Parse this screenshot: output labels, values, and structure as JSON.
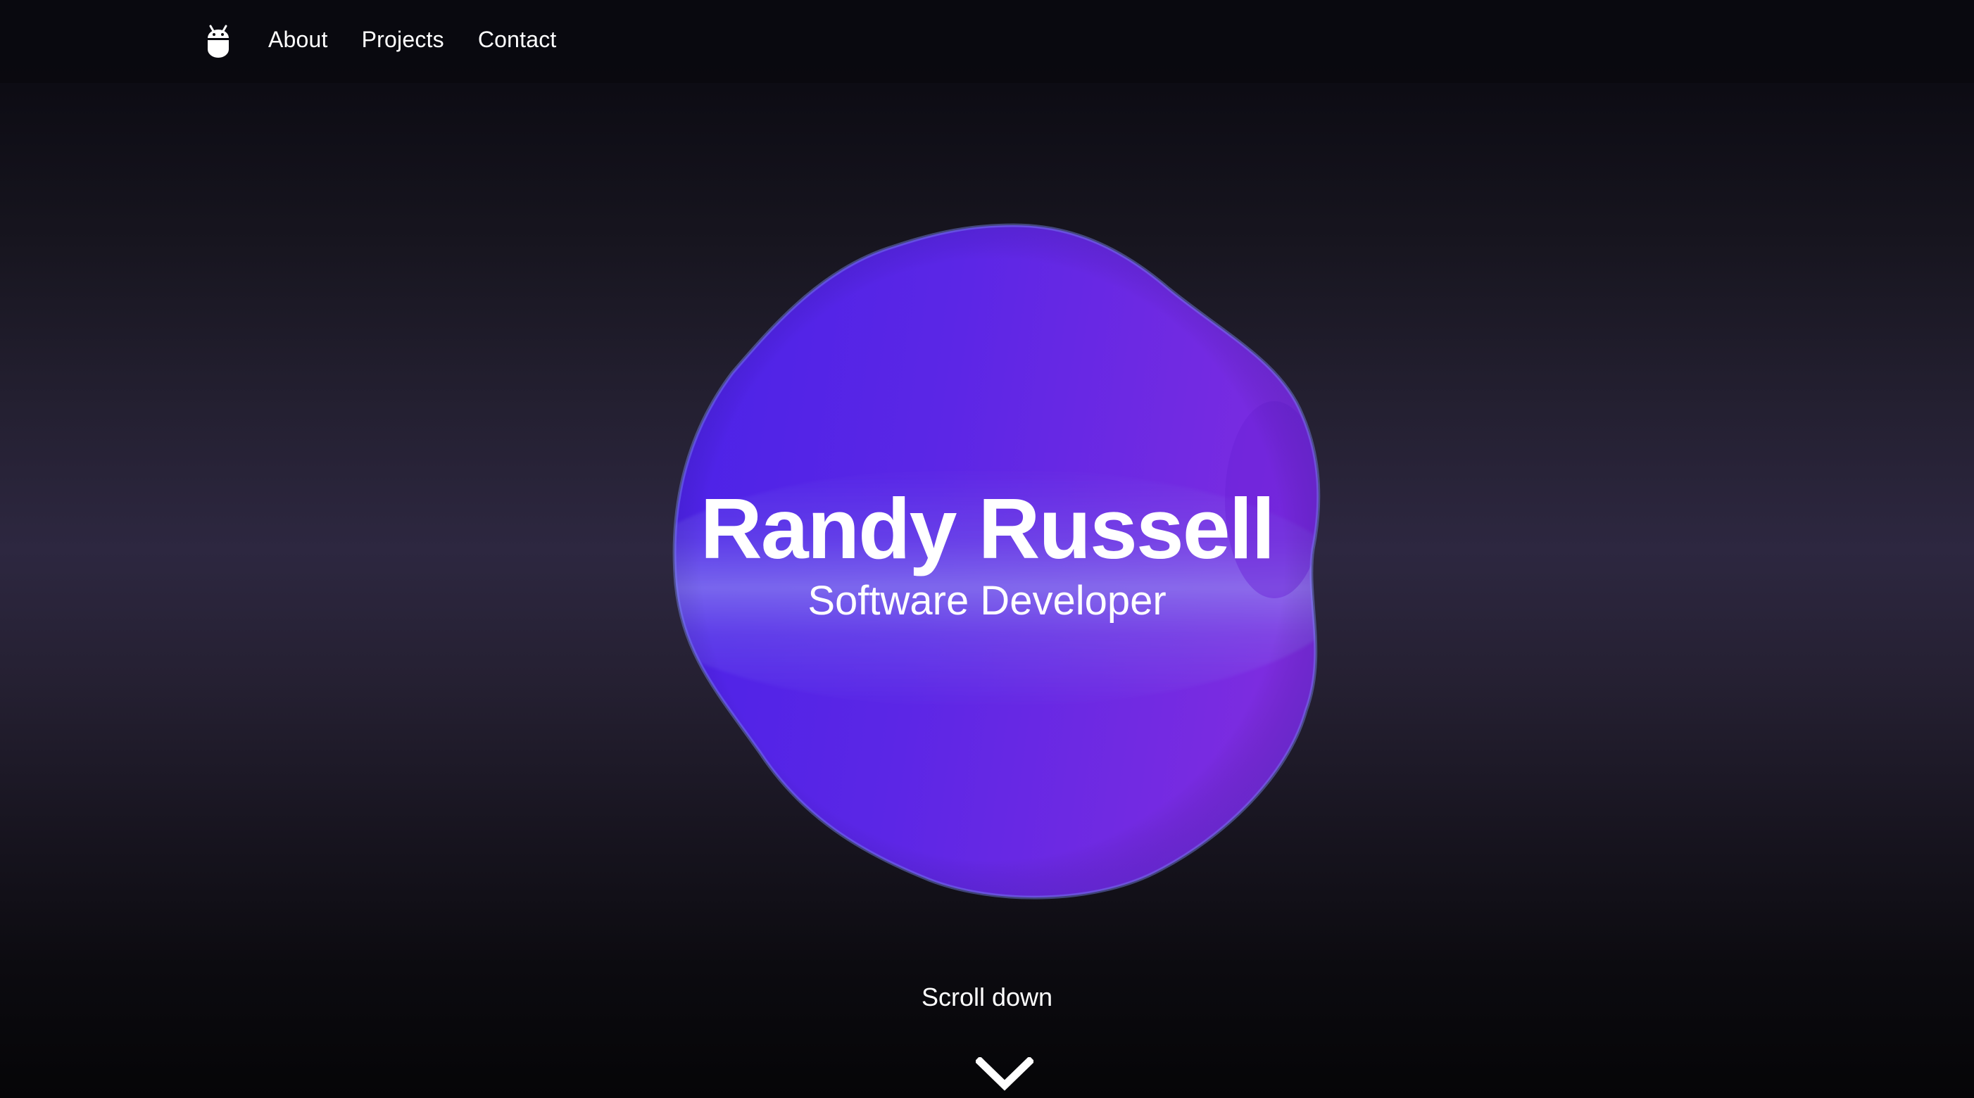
{
  "nav": {
    "logo_icon": "android-bot-icon",
    "links": [
      {
        "label": "About"
      },
      {
        "label": "Projects"
      },
      {
        "label": "Contact"
      }
    ]
  },
  "hero": {
    "title": "Randy Russell",
    "subtitle": "Software Developer"
  },
  "scroll": {
    "label": "Scroll down",
    "icon": "chevron-down-icon"
  },
  "colors": {
    "background_dark": "#0a0a0f",
    "background_glow": "#2d2740",
    "blob_blue": "#4f22e6",
    "blob_purple": "#7b2be0",
    "blob_highlight": "#7b7fe8",
    "text": "#ffffff"
  }
}
